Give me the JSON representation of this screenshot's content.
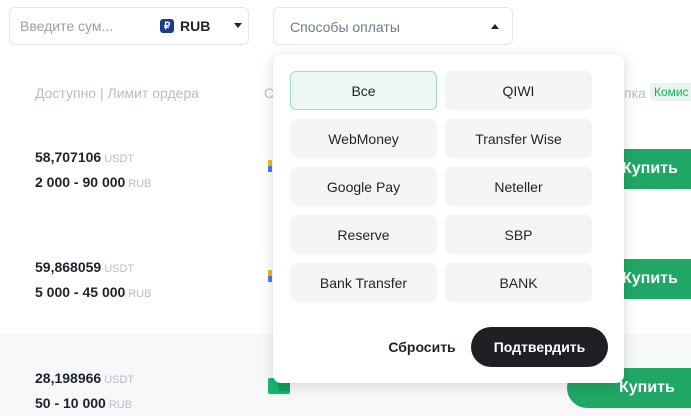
{
  "filters": {
    "amount_placeholder": "Введите сум...",
    "currency": {
      "code": "RUB",
      "symbol": "₽"
    },
    "payment_methods_label": "Способы оплаты"
  },
  "table_header": {
    "available_limit": "Доступно | Лимит ордера",
    "payment_partial": "Сп",
    "right_partial": "пка",
    "fee_badge": "Комис"
  },
  "offers": [
    {
      "available": "58,707106",
      "available_unit": "USDT",
      "limit": "2 000 - 90 000",
      "limit_unit": "RUB",
      "buy_label": "Купить"
    },
    {
      "available": "59,868059",
      "available_unit": "USDT",
      "limit": "5 000 - 45 000",
      "limit_unit": "RUB",
      "buy_label": "Купить"
    },
    {
      "available": "28,198966",
      "available_unit": "USDT",
      "limit": "50 - 10 000",
      "limit_unit": "RUB",
      "buy_label": "Купить"
    }
  ],
  "payment_dropdown": {
    "options": [
      "Все",
      "QIWI",
      "WebMoney",
      "Transfer Wise",
      "Google Pay",
      "Neteller",
      "Reserve",
      "SBP",
      "Bank Transfer",
      "BANK"
    ],
    "selected": "Все",
    "reset_label": "Сбросить",
    "confirm_label": "Подтвердить"
  },
  "colors": {
    "accent_green": "#20a765",
    "dark_button": "#1e2026"
  }
}
